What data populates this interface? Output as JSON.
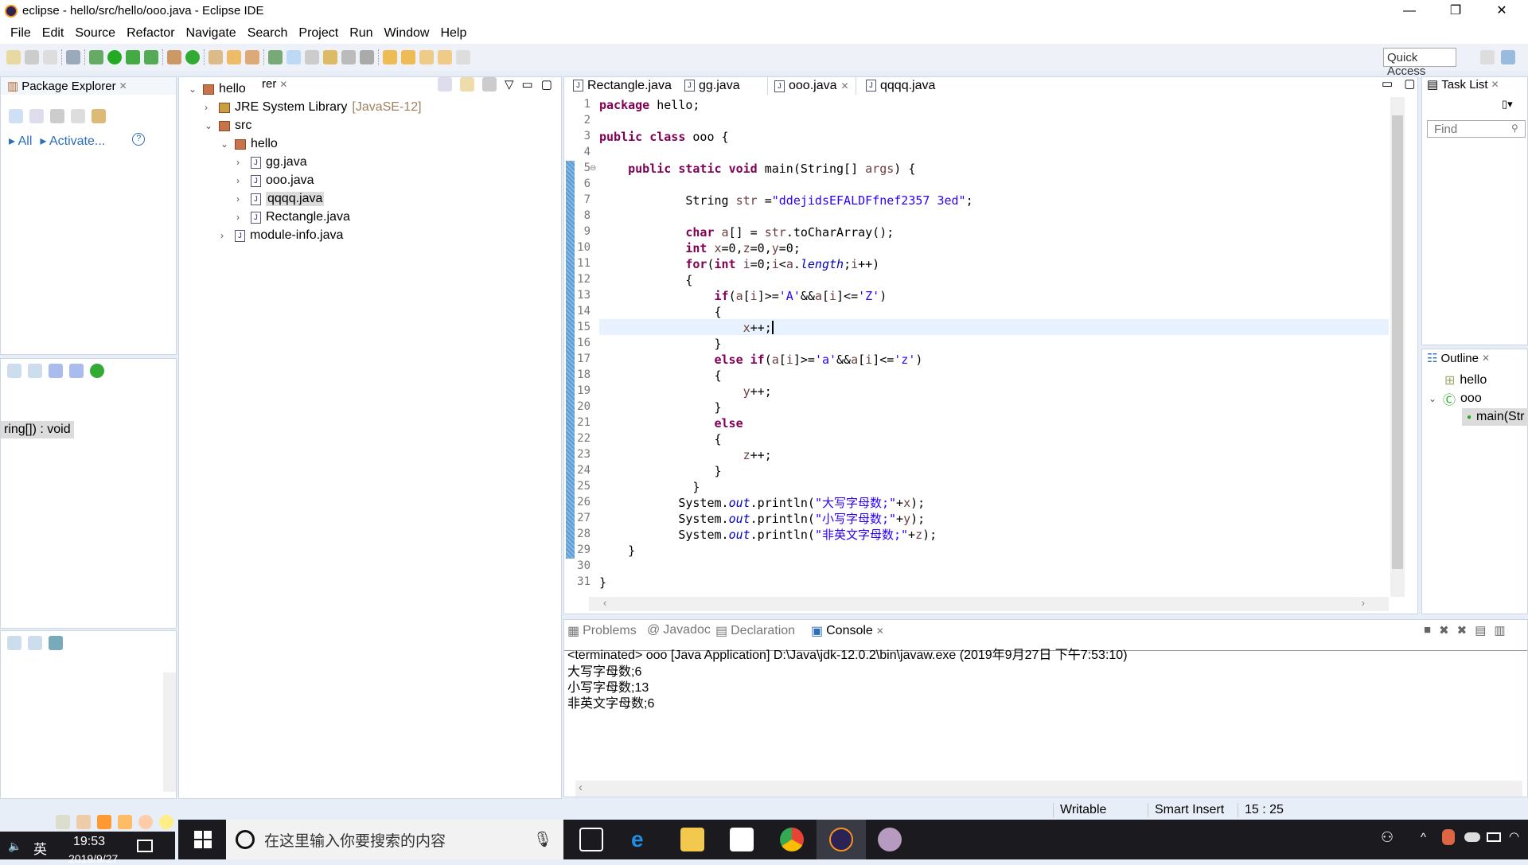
{
  "window": {
    "title": "eclipse - hello/src/hello/ooo.java - Eclipse IDE",
    "minimize": "—",
    "restore": "❐",
    "close": "✕"
  },
  "menu": [
    "File",
    "Edit",
    "Source",
    "Refactor",
    "Navigate",
    "Search",
    "Project",
    "Run",
    "Window",
    "Help"
  ],
  "quick_access": "Quick Access",
  "package_explorer": {
    "tab": "Package Explorer",
    "tab2": "rer",
    "filter_all": "All",
    "activate": "Activate...",
    "help": "?",
    "tree": [
      {
        "label": "hello",
        "level": 0,
        "expanded": true,
        "icon": "project-icon"
      },
      {
        "label": "JRE System Library",
        "suffix": "[JavaSE-12]",
        "level": 1,
        "expanded": false,
        "icon": "library-icon"
      },
      {
        "label": "src",
        "level": 1,
        "expanded": true,
        "icon": "source-folder-icon"
      },
      {
        "label": "hello",
        "level": 2,
        "expanded": true,
        "icon": "package-icon"
      },
      {
        "label": "gg.java",
        "level": 3,
        "expanded": false,
        "icon": "java-file-icon"
      },
      {
        "label": "ooo.java",
        "level": 3,
        "expanded": false,
        "icon": "java-file-icon"
      },
      {
        "label": "qqqq.java",
        "level": 3,
        "expanded": false,
        "icon": "java-file-icon",
        "selected": true
      },
      {
        "label": "Rectangle.java",
        "level": 3,
        "expanded": false,
        "icon": "java-file-error-icon"
      },
      {
        "label": "module-info.java",
        "level": 2,
        "expanded": false,
        "icon": "java-file-icon"
      }
    ]
  },
  "left_mid": {
    "method": "ring[]) : void"
  },
  "editor": {
    "tabs": [
      {
        "label": "Rectangle.java"
      },
      {
        "label": "gg.java"
      },
      {
        "label": "ooo.java",
        "active": true
      },
      {
        "label": "qqqq.java"
      }
    ],
    "lines": [
      [
        [
          "k",
          "package"
        ],
        [
          "t",
          " hello;"
        ]
      ],
      [],
      [
        [
          "k",
          "public"
        ],
        [
          "t",
          " "
        ],
        [
          "k",
          "class"
        ],
        [
          "t",
          " ooo {"
        ]
      ],
      [],
      [
        [
          "t",
          "    "
        ],
        [
          "k",
          "public"
        ],
        [
          "t",
          " "
        ],
        [
          "k",
          "static"
        ],
        [
          "t",
          " "
        ],
        [
          "k",
          "void"
        ],
        [
          "t",
          " main(String[] "
        ],
        [
          "v",
          "args"
        ],
        [
          "t",
          ") {"
        ]
      ],
      [],
      [
        [
          "t",
          "            String "
        ],
        [
          "v",
          "str"
        ],
        [
          "t",
          " ="
        ],
        [
          "s",
          "\"ddejidsEFALDFfnef2357 3ed\""
        ],
        [
          "t",
          ";"
        ]
      ],
      [],
      [
        [
          "t",
          "            "
        ],
        [
          "k",
          "char"
        ],
        [
          "t",
          " "
        ],
        [
          "v",
          "a"
        ],
        [
          "t",
          "[] = "
        ],
        [
          "v",
          "str"
        ],
        [
          "t",
          ".toCharArray();"
        ]
      ],
      [
        [
          "t",
          "            "
        ],
        [
          "k",
          "int"
        ],
        [
          "t",
          " "
        ],
        [
          "v",
          "x"
        ],
        [
          "t",
          "=0,"
        ],
        [
          "v",
          "z"
        ],
        [
          "t",
          "=0,"
        ],
        [
          "v",
          "y"
        ],
        [
          "t",
          "=0;"
        ]
      ],
      [
        [
          "t",
          "            "
        ],
        [
          "k",
          "for"
        ],
        [
          "t",
          "("
        ],
        [
          "k",
          "int"
        ],
        [
          "t",
          " "
        ],
        [
          "v",
          "i"
        ],
        [
          "t",
          "=0;"
        ],
        [
          "v",
          "i"
        ],
        [
          "t",
          "<"
        ],
        [
          "v",
          "a"
        ],
        [
          "t",
          "."
        ],
        [
          "f",
          "length"
        ],
        [
          "t",
          ";"
        ],
        [
          "v",
          "i"
        ],
        [
          "t",
          "++)"
        ]
      ],
      [
        [
          "t",
          "            {"
        ]
      ],
      [
        [
          "t",
          "                "
        ],
        [
          "k",
          "if"
        ],
        [
          "t",
          "("
        ],
        [
          "v",
          "a"
        ],
        [
          "t",
          "["
        ],
        [
          "v",
          "i"
        ],
        [
          "t",
          "]>="
        ],
        [
          "s",
          "'A'"
        ],
        [
          "t",
          "&&"
        ],
        [
          "v",
          "a"
        ],
        [
          "t",
          "["
        ],
        [
          "v",
          "i"
        ],
        [
          "t",
          "]<="
        ],
        [
          "s",
          "'Z'"
        ],
        [
          "t",
          ")"
        ]
      ],
      [
        [
          "t",
          "                {"
        ]
      ],
      [
        [
          "t",
          "                    "
        ],
        [
          "v",
          "x"
        ],
        [
          "t",
          "++;"
        ]
      ],
      [
        [
          "t",
          "                }"
        ]
      ],
      [
        [
          "t",
          "                "
        ],
        [
          "k",
          "else"
        ],
        [
          "t",
          " "
        ],
        [
          "k",
          "if"
        ],
        [
          "t",
          "("
        ],
        [
          "v",
          "a"
        ],
        [
          "t",
          "["
        ],
        [
          "v",
          "i"
        ],
        [
          "t",
          "]>="
        ],
        [
          "s",
          "'a'"
        ],
        [
          "t",
          "&&"
        ],
        [
          "v",
          "a"
        ],
        [
          "t",
          "["
        ],
        [
          "v",
          "i"
        ],
        [
          "t",
          "]<="
        ],
        [
          "s",
          "'z'"
        ],
        [
          "t",
          ")"
        ]
      ],
      [
        [
          "t",
          "                {"
        ]
      ],
      [
        [
          "t",
          "                    "
        ],
        [
          "v",
          "y"
        ],
        [
          "t",
          "++;"
        ]
      ],
      [
        [
          "t",
          "                }"
        ]
      ],
      [
        [
          "t",
          "                "
        ],
        [
          "k",
          "else"
        ]
      ],
      [
        [
          "t",
          "                {"
        ]
      ],
      [
        [
          "t",
          "                    "
        ],
        [
          "v",
          "z"
        ],
        [
          "t",
          "++;"
        ]
      ],
      [
        [
          "t",
          "                }"
        ]
      ],
      [
        [
          "t",
          "             }"
        ]
      ],
      [
        [
          "t",
          "           System."
        ],
        [
          "f",
          "out"
        ],
        [
          "t",
          ".println("
        ],
        [
          "s",
          "\"大写字母数;\""
        ],
        [
          "t",
          "+"
        ],
        [
          "v",
          "x"
        ],
        [
          "t",
          ");"
        ]
      ],
      [
        [
          "t",
          "           System."
        ],
        [
          "f",
          "out"
        ],
        [
          "t",
          ".println("
        ],
        [
          "s",
          "\"小写字母数;\""
        ],
        [
          "t",
          "+"
        ],
        [
          "v",
          "y"
        ],
        [
          "t",
          ");"
        ]
      ],
      [
        [
          "t",
          "           System."
        ],
        [
          "f",
          "out"
        ],
        [
          "t",
          ".println("
        ],
        [
          "s",
          "\"非英文字母数;\""
        ],
        [
          "t",
          "+"
        ],
        [
          "v",
          "z"
        ],
        [
          "t",
          ");"
        ]
      ],
      [
        [
          "t",
          "    }"
        ]
      ],
      [],
      [
        [
          "t",
          "}"
        ]
      ]
    ]
  },
  "task_list": {
    "tab": "Task List",
    "find_placeholder": "Find"
  },
  "outline": {
    "tab": "Outline",
    "items": [
      "hello",
      "ooo",
      "main(Str"
    ]
  },
  "console": {
    "tabs": [
      "Problems",
      "Javadoc",
      "Declaration",
      "Console"
    ],
    "header": "<terminated> ooo [Java Application] D:\\Java\\jdk-12.0.2\\bin\\javaw.exe (2019年9月27日 下午7:53:10)",
    "output": [
      "大写字母数;6",
      "小写字母数;13",
      "非英文字母数;6"
    ]
  },
  "status": {
    "writable": "Writable",
    "insert_mode": "Smart Insert",
    "position": "15 : 25"
  },
  "taskbar": {
    "search_placeholder": "在这里输入你要搜索的内容",
    "clock_time": "19:53",
    "clock_date": "2019/9/27",
    "ime": "英"
  }
}
